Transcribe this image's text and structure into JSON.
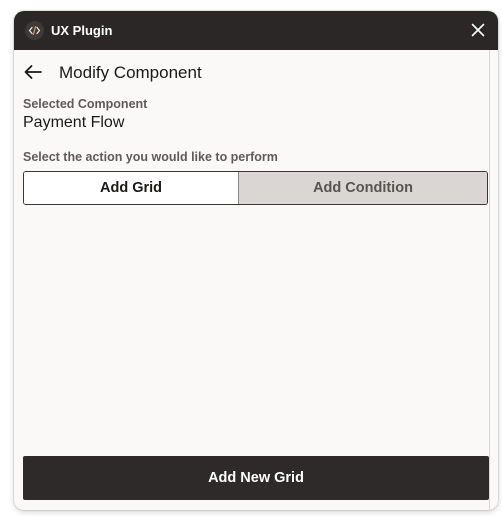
{
  "window": {
    "app_title": "UX Plugin",
    "app_icon": "code-icon",
    "close_icon": "close-icon"
  },
  "header": {
    "back_icon": "arrow-left-icon",
    "title": "Modify Component"
  },
  "selected_component": {
    "label": "Selected Component",
    "value": "Payment Flow"
  },
  "action": {
    "prompt": "Select the action you would like to perform",
    "options": [
      {
        "label": "Add Grid",
        "selected": true
      },
      {
        "label": "Add Condition",
        "selected": false
      }
    ]
  },
  "footer": {
    "primary_label": "Add New Grid"
  },
  "colors": {
    "titlebar": "#2a2726",
    "background": "#fbf9f7",
    "primary_button": "#2d2a29",
    "segment_inactive": "#d9d6d4"
  }
}
